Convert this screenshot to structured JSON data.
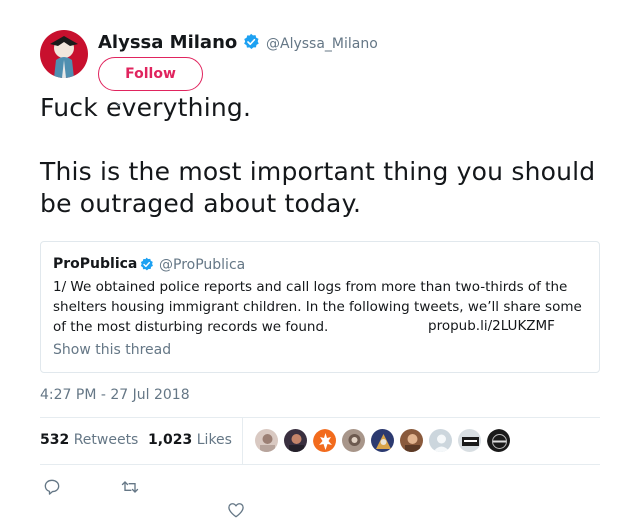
{
  "author": {
    "name": "Alyssa Milano",
    "handle": "@Alyssa_Milano",
    "follow_label": "Follow"
  },
  "tweet": {
    "line1": "Fuck everything.",
    "line2": "This is the most important thing you should be outraged about today.",
    "timestamp": "4:27 PM - 27 Jul 2018"
  },
  "quoted": {
    "name": "ProPublica",
    "handle": "@ProPublica",
    "text": "1/ We obtained police reports and call logs from more than two-thirds of the shelters housing immigrant children. In the following tweets, we’ll share some of the most disturbing records we found.",
    "link": "propub.li/2LUKZMF",
    "show_thread": "Show this thread"
  },
  "stats": {
    "retweets_count": "532",
    "retweets_label": "Retweets",
    "likes_count": "1,023",
    "likes_label": "Likes"
  },
  "liker_avatars": [
    {
      "icon": "avatar-photo-1",
      "color": "#d9c9c2"
    },
    {
      "icon": "avatar-photo-2",
      "color": "#3a3040"
    },
    {
      "icon": "rebel-alliance-icon",
      "color": "#f26b1d"
    },
    {
      "icon": "avatar-photo-4",
      "color": "#a8968a"
    },
    {
      "icon": "avatar-photo-5",
      "color": "#2c3a70"
    },
    {
      "icon": "avatar-photo-6",
      "color": "#8a5a3c"
    },
    {
      "icon": "default-avatar-icon",
      "color": "#ccd6dd"
    },
    {
      "icon": "avatar-logo-8",
      "color": "#d8dee2"
    },
    {
      "icon": "avatar-logo-9",
      "color": "#1a1a1a"
    }
  ],
  "colors": {
    "accent_like": "#e0245e",
    "verified": "#1da1f2",
    "muted": "#657786"
  }
}
